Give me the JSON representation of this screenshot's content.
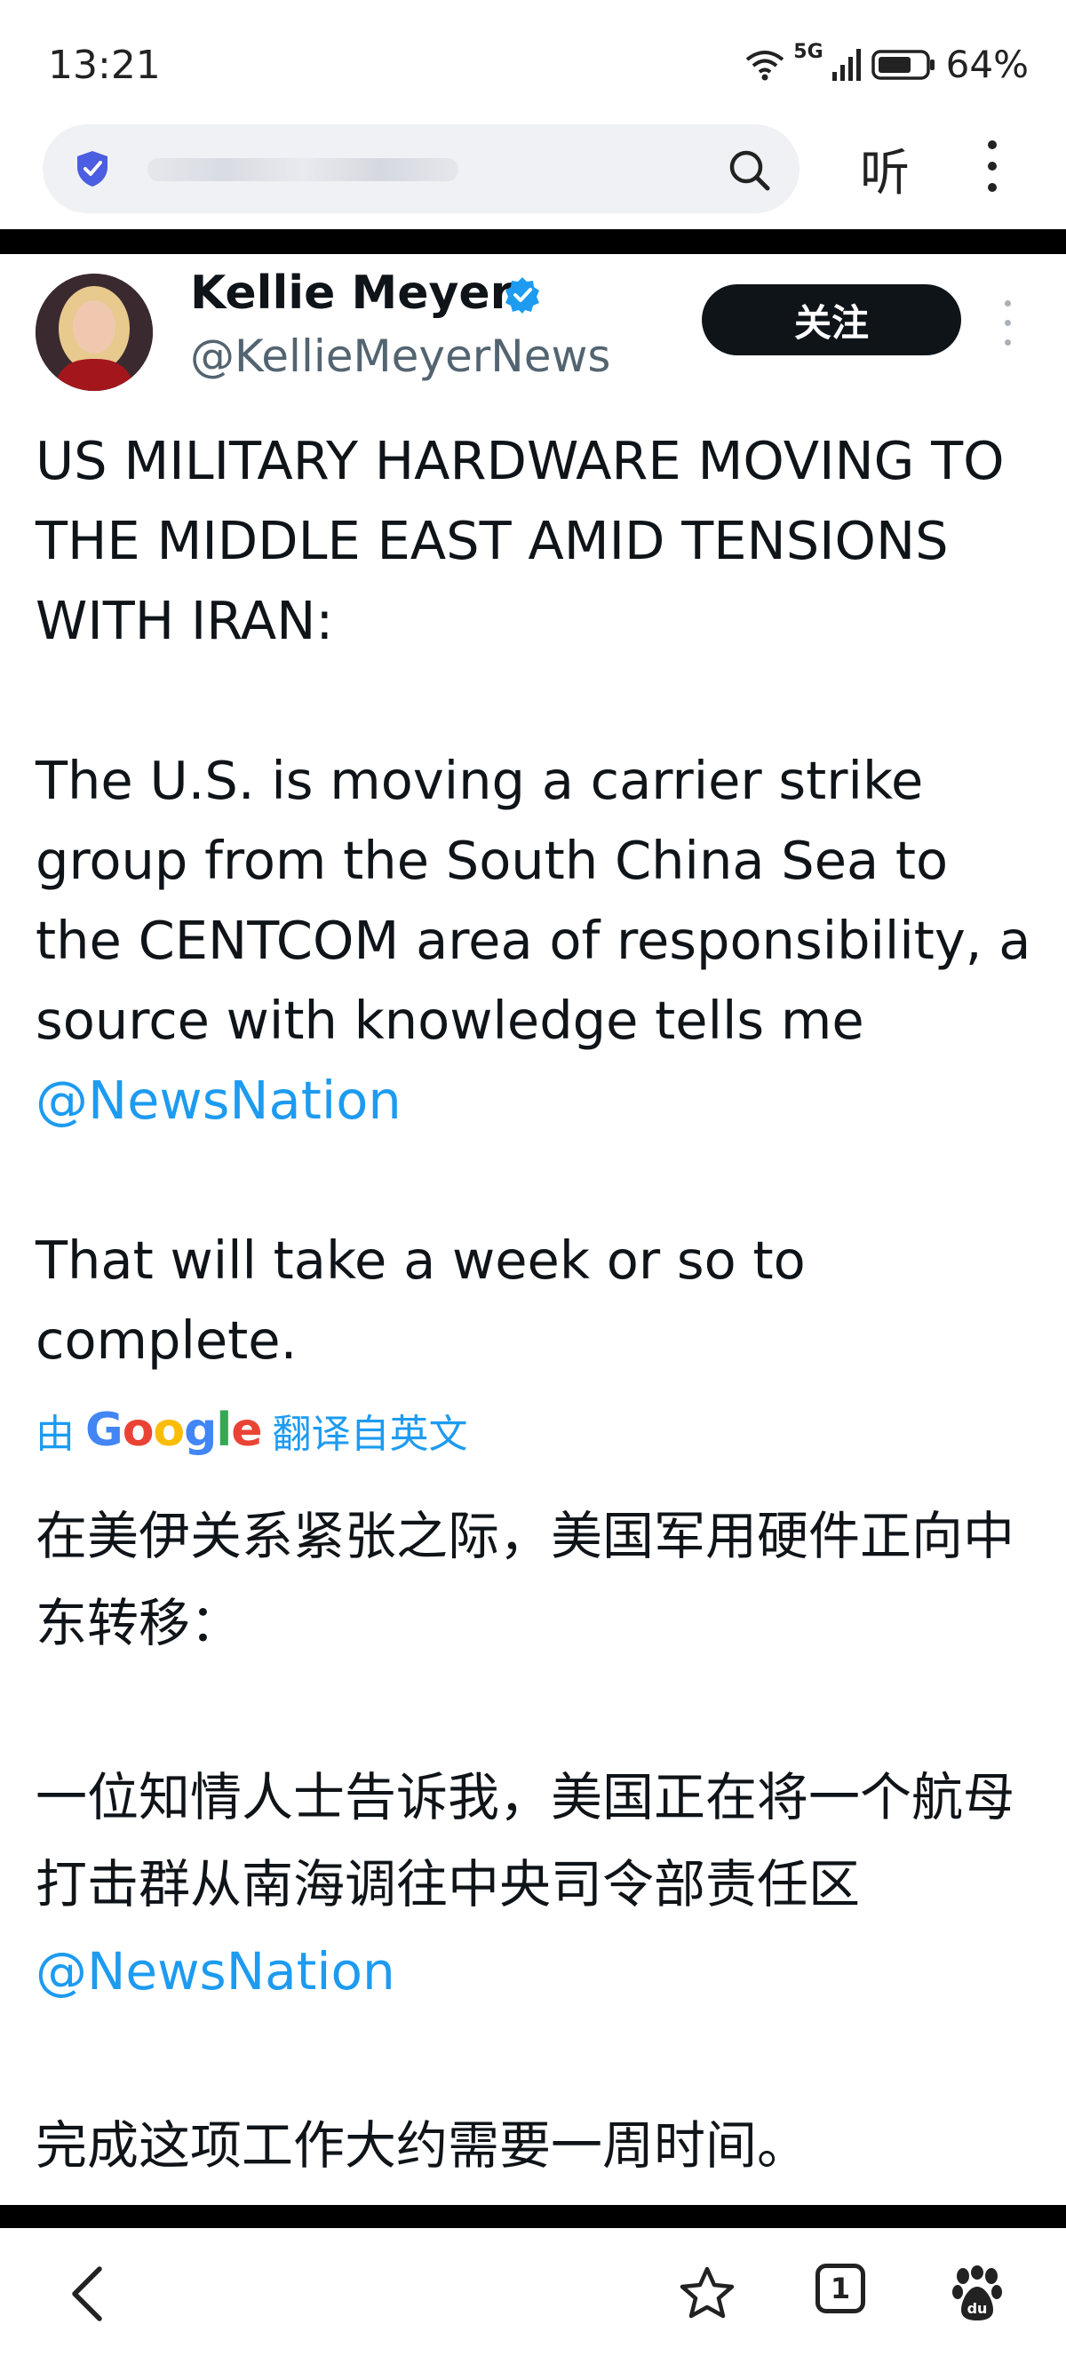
{
  "status_bar": {
    "time": "13:21",
    "network": "5G",
    "battery": "64%"
  },
  "browser": {
    "listen_label": "听"
  },
  "tweet": {
    "author_name": "Kellie Meyer",
    "handle": "@KellieMeyerNews",
    "follow_label": "关注",
    "paragraphs": {
      "p1": "US MILITARY HARDWARE MOVING TO THE MIDDLE EAST AMID TENSIONS WITH IRAN:",
      "p2": "The U.S. is moving a carrier strike group from the South China Sea to the CENTCOM area of responsibility, a source with knowledge tells me ",
      "p2_mention": "@NewsNation",
      "p3": "That will take a week or so to complete."
    },
    "translate_prefix": "由",
    "translate_brand": "Google",
    "translate_suffix": "翻译自英文",
    "translated": {
      "p1": "在美伊关系紧张之际，美国军用硬件正向中东转移：",
      "p2": "一位知情人士告诉我，美国正在将一个航母打击群从南海调往中央司令部责任区",
      "p2_mention": "@NewsNation",
      "p3": "完成这项工作大约需要一周时间。"
    }
  },
  "bottom_nav": {
    "tab_count": "1"
  },
  "colors": {
    "link": "#1d9bf0",
    "text": "#0f1419",
    "secondary": "#536471",
    "verified": "#1d9bf0"
  }
}
